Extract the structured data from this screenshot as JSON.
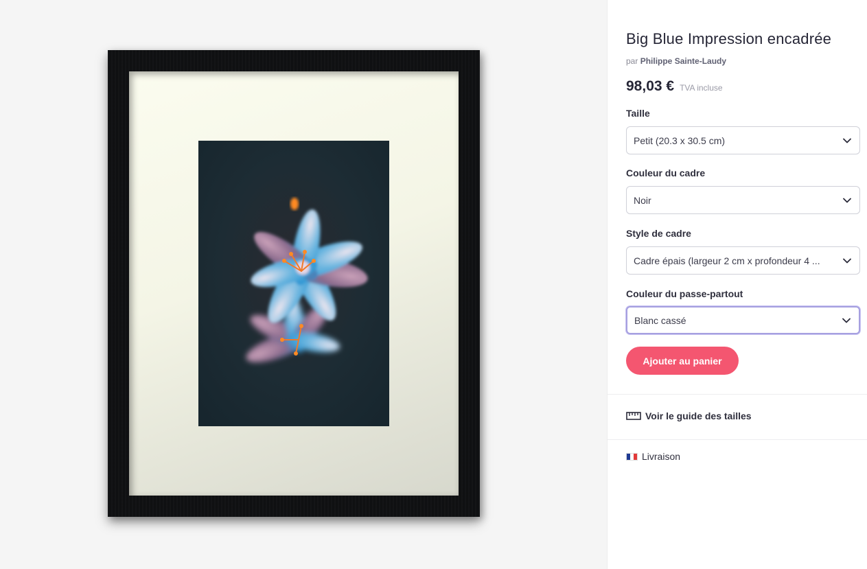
{
  "product": {
    "title": "Big Blue Impression encadrée",
    "by_prefix": "par",
    "artist": "Philippe Sainte-Laudy",
    "price": "98,03 €",
    "vat_note": "TVA incluse"
  },
  "options": {
    "size": {
      "label": "Taille",
      "value": "Petit (20.3 x 30.5 cm)"
    },
    "frame_color": {
      "label": "Couleur du cadre",
      "value": "Noir"
    },
    "frame_style": {
      "label": "Style de cadre",
      "value": "Cadre épais (largeur 2 cm x profondeur 4 ..."
    },
    "mat_color": {
      "label": "Couleur du passe-partout",
      "value": "Blanc cassé"
    }
  },
  "actions": {
    "add_to_cart": "Ajouter au panier",
    "size_guide": "Voir le guide des tailles",
    "shipping": "Livraison"
  },
  "icons": {
    "dropdown": "chevron-down-icon",
    "size_guide": "ruler-icon",
    "shipping": "france-flag-icon"
  },
  "colors": {
    "cta": "#f45670",
    "focus_border": "#a6a0e0",
    "frame": "#0f1012",
    "mat": "#f8f9ec"
  }
}
